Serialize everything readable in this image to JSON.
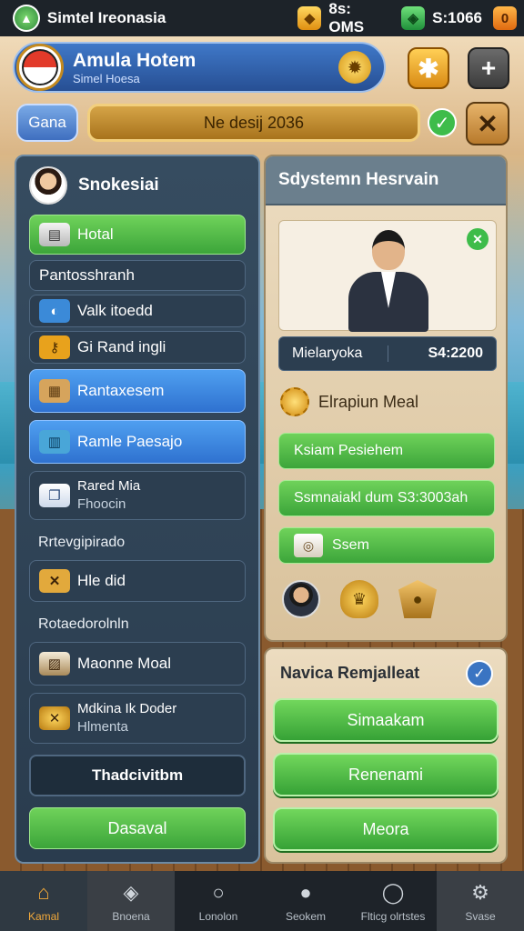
{
  "status_bar": {
    "app_title": "Simtel Ireonasia",
    "stats": [
      {
        "icon": "gold-bar-icon",
        "value": "8s: OMS"
      },
      {
        "icon": "gem-icon",
        "value": "S:1066"
      },
      {
        "icon": "cash-icon",
        "value": "0"
      }
    ]
  },
  "header": {
    "hotel_name": "Amula Hotem",
    "hotel_subtitle": "Simel Hoesa"
  },
  "search": {
    "game_label": "Gana",
    "field_value": "Ne desij 2036"
  },
  "left_panel": {
    "title": "Snokesiai",
    "items": [
      {
        "label": "Hotal",
        "icon": "hotel-icon"
      },
      {
        "label": "Pantosshranh",
        "icon": ""
      },
      {
        "label": "Valk itoedd",
        "icon": "globe-icon"
      },
      {
        "label": "Gi Rand ingli",
        "icon": "key-icon"
      },
      {
        "label": "Rantaxesem",
        "icon": "box-icon"
      },
      {
        "label": "Ramle Paesajo",
        "icon": "bag-icon"
      },
      {
        "label_1": "Rared Mia",
        "label_2": "Fhoocin",
        "icon": "documents-icon"
      },
      {
        "label": "Rrtevgipirado",
        "icon": ""
      },
      {
        "label": "Hle did",
        "icon": "x-box-icon"
      },
      {
        "label": "Rotaedorolnln",
        "icon": ""
      },
      {
        "label": "Maonne Moal",
        "icon": "photo-icon"
      },
      {
        "label_1": "Mdkina Ik Doder",
        "label_2": "Hlmenta",
        "icon": "coin-icon"
      },
      {
        "label": "Thadcivitbm",
        "icon": ""
      },
      {
        "label": "Dasaval",
        "icon": ""
      }
    ]
  },
  "right_panel": {
    "title": "Sdystemn Hesrvain",
    "info_left": "Mielaryoka",
    "info_right": "S4:2200",
    "meal_heading": "Elrapiun Meal",
    "buttons": [
      "Ksiam Pesiehem",
      "Ssmnaiakl dum S3:3003ah",
      "Ssem"
    ]
  },
  "right_panel_2": {
    "title": "Navica Remjalleat",
    "buttons": [
      "Simaakam",
      "Renenami",
      "Meora"
    ]
  },
  "bottom_nav": [
    {
      "label": "Kamal",
      "icon": "home-icon"
    },
    {
      "label": "Bnoena",
      "icon": "stack-icon"
    },
    {
      "label": "Lonolon",
      "icon": "search-icon"
    },
    {
      "label": "Seokem",
      "icon": "person-icon"
    },
    {
      "label": "Flticg olrtstes",
      "icon": "ring-icon"
    },
    {
      "label": "Svase",
      "icon": "settings-icon"
    }
  ],
  "colors": {
    "accent_green": "#3ca53a",
    "accent_blue": "#2f72d0",
    "panel_dark": "#2a3c4e",
    "panel_light": "#ecdcc0",
    "nav_active": "#f2a93a"
  }
}
